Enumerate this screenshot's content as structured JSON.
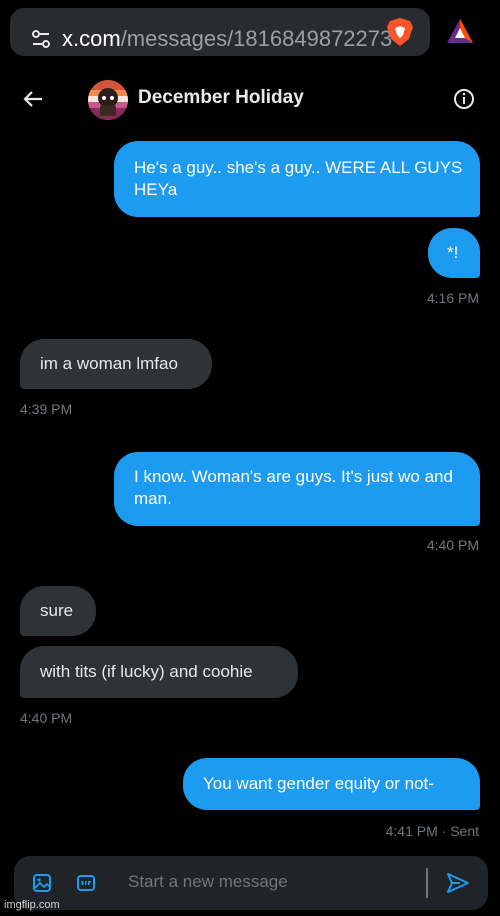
{
  "browser": {
    "url_host": "x.com",
    "url_path": "/messages/1816849872273"
  },
  "header": {
    "title": "December Holiday"
  },
  "messages": [
    {
      "direction": "out",
      "text": "He's a guy.. she's a guy..  WERE ALL GUYS HEYa"
    },
    {
      "direction": "out",
      "text": "*!",
      "time": "4:16 PM"
    },
    {
      "direction": "in",
      "text": "im a woman lmfao",
      "time": "4:39 PM"
    },
    {
      "direction": "out",
      "text": "I know. Woman's are guys. It's just wo and man.",
      "time": "4:40 PM"
    },
    {
      "direction": "in",
      "text": "sure"
    },
    {
      "direction": "in",
      "text": "with tits (if lucky) and coohie",
      "time": "4:40 PM"
    },
    {
      "direction": "out",
      "text": "You want gender equity or not-",
      "time": "4:41 PM · Sent"
    }
  ],
  "composer": {
    "placeholder": "Start a new message"
  },
  "watermark": "imgflip.com",
  "colors": {
    "outgoing_bubble": "#1d9bf0",
    "incoming_bubble": "#2f3336",
    "accent": "#1d9bf0"
  }
}
